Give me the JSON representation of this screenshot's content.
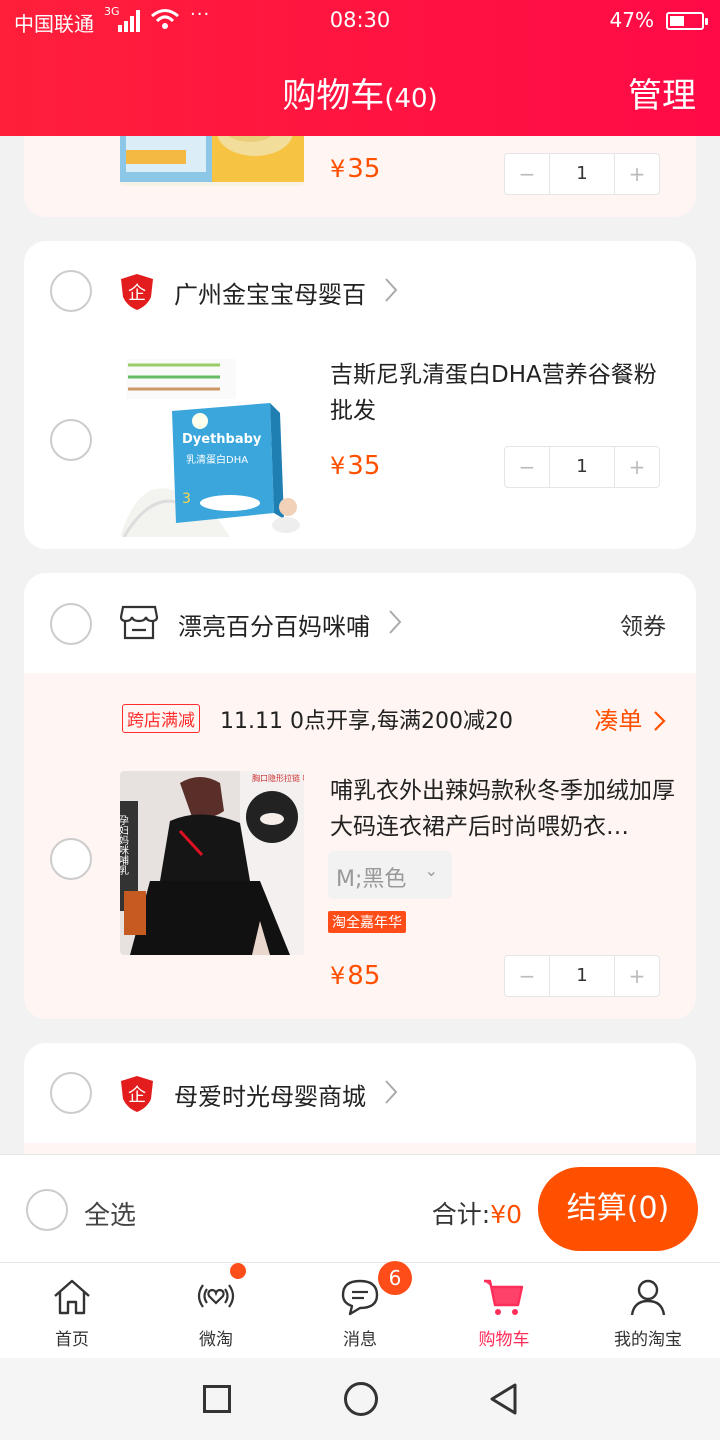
{
  "status_bar": {
    "carrier": "中国联通",
    "network": "3G",
    "dots": "···",
    "time": "08:30",
    "battery": "47%",
    "battery_level": 0.47
  },
  "header": {
    "title": "购物车",
    "count": "(40)",
    "manage": "管理"
  },
  "colors": {
    "brand_red": "#ff1f3a",
    "accent_orange": "#ff5000",
    "promo_bg": "#fff5f2"
  },
  "stores": [
    {
      "items": [
        {
          "price_symbol": "¥",
          "price": "35",
          "quantity": "1"
        }
      ]
    },
    {
      "name": "广州金宝宝母婴百",
      "icon": "shield-brand-icon",
      "items": [
        {
          "name": "吉斯尼乳清蛋白DHA营养谷餐粉批发",
          "price_symbol": "¥",
          "price": "35",
          "quantity": "1",
          "image_text": {
            "brand": "Dyethbaby",
            "sub": "乳清蛋白DHA",
            "stage": "3"
          }
        }
      ]
    },
    {
      "name": "漂亮百分百妈咪哺",
      "icon": "store-icon",
      "coupon": "领券",
      "promo": {
        "tag": "跨店满减",
        "text": "11.11 0点开享,每满200减20",
        "link": "凑单"
      },
      "items": [
        {
          "name": "哺乳衣外出辣妈款秋冬季加绒加厚大码连衣裙产后时尚喂奶衣…",
          "sku": "M;黑色",
          "badge": "淘全嘉年华",
          "price_symbol": "¥",
          "price": "85",
          "quantity": "1",
          "image_text": {
            "side": "孕妇妈咪哺乳",
            "top": "胸口隐形拉链 哺乳口"
          }
        }
      ]
    },
    {
      "name": "母爱时光母婴商城",
      "icon": "shield-brand-icon"
    }
  ],
  "qty_controls": {
    "minus": "−",
    "plus": "+"
  },
  "checkout": {
    "select_all": "全选",
    "total_label": "合计:",
    "total_symbol": "¥",
    "total_value": "0",
    "pay_button": "结算(0)"
  },
  "tabs": [
    {
      "label": "首页",
      "icon": "home-icon"
    },
    {
      "label": "微淘",
      "icon": "broadcast-heart-icon",
      "dot": true
    },
    {
      "label": "消息",
      "icon": "message-icon",
      "badge": "6"
    },
    {
      "label": "购物车",
      "icon": "cart-icon",
      "active": true
    },
    {
      "label": "我的淘宝",
      "icon": "user-icon"
    }
  ]
}
